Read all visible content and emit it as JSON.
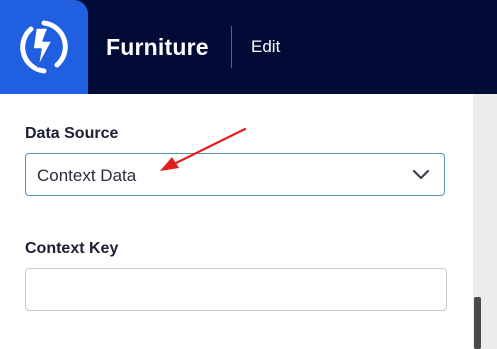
{
  "header": {
    "app_icon": "lightning-bolt-icon",
    "title": "Furniture",
    "edit_label": "Edit"
  },
  "form": {
    "data_source": {
      "label": "Data Source",
      "selected_value": "Context Data",
      "chevron_icon": "chevron-down-icon"
    },
    "context_key": {
      "label": "Context Key",
      "value": "",
      "placeholder": ""
    }
  },
  "annotation": {
    "type": "arrow",
    "color": "#e02020",
    "points_to": "Context Data"
  },
  "colors": {
    "header_bg": "#020b36",
    "logo_bg": "#1f5fe0",
    "select_border": "#4f95b5",
    "annotation": "#e02020"
  }
}
